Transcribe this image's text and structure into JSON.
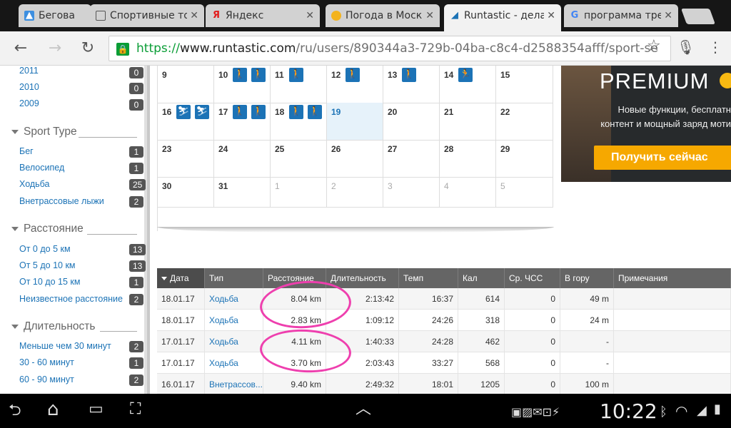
{
  "browser": {
    "tabs": [
      {
        "label": "Беговая с",
        "favicon": "drive-icon",
        "active": false
      },
      {
        "label": "Спортивные то",
        "favicon": "page-icon",
        "active": false
      },
      {
        "label": "Яндекс",
        "favicon": "yandex-icon",
        "active": false
      },
      {
        "label": "Погода в Моск",
        "favicon": "weather-icon",
        "active": false
      },
      {
        "label": "Runtastic - дела",
        "favicon": "runtastic-icon",
        "active": true
      },
      {
        "label": "программа тре",
        "favicon": "google-icon",
        "active": false
      }
    ],
    "url": {
      "scheme": "https://",
      "host": "www.runtastic.com",
      "path": "/ru/users/890344a3-729b-04ba-c8c4-d2588354afff/sport-se"
    }
  },
  "sidebar": {
    "years": [
      {
        "label": "2011",
        "count": "0"
      },
      {
        "label": "2010",
        "count": "0"
      },
      {
        "label": "2009",
        "count": "0"
      }
    ],
    "sport_type": {
      "heading": "Sport Type",
      "items": [
        {
          "label": "Бег",
          "count": "1"
        },
        {
          "label": "Велосипед",
          "count": "1"
        },
        {
          "label": "Ходьба",
          "count": "25"
        },
        {
          "label": "Внетрассовые лыжи",
          "count": "2"
        }
      ]
    },
    "distance": {
      "heading": "Расстояние",
      "items": [
        {
          "label": "От 0 до 5 км",
          "count": "13"
        },
        {
          "label": "От 5 до 10 км",
          "count": "13"
        },
        {
          "label": "От 10 до 15 км",
          "count": "1"
        },
        {
          "label": "Неизвестное расстояние",
          "count": "2"
        }
      ]
    },
    "duration": {
      "heading": "Длительность",
      "items": [
        {
          "label": "Меньше чем 30 минут",
          "count": "2"
        },
        {
          "label": "30 - 60 минут",
          "count": "1"
        },
        {
          "label": "60 - 90 минут",
          "count": "2"
        }
      ]
    }
  },
  "calendar": {
    "weeks": [
      [
        {
          "day": "9",
          "icons": []
        },
        {
          "day": "10",
          "icons": [
            "walking-icon",
            "walking-icon"
          ]
        },
        {
          "day": "11",
          "icons": [
            "walking-icon"
          ]
        },
        {
          "day": "12",
          "icons": [
            "walking-icon"
          ]
        },
        {
          "day": "13",
          "icons": [
            "walking-icon"
          ]
        },
        {
          "day": "14",
          "icons": [
            "running-icon"
          ]
        },
        {
          "day": "15",
          "icons": []
        }
      ],
      [
        {
          "day": "16",
          "icons": [
            "skiing-icon",
            "skiing-icon"
          ]
        },
        {
          "day": "17",
          "icons": [
            "walking-icon",
            "walking-icon"
          ]
        },
        {
          "day": "18",
          "icons": [
            "walking-icon",
            "walking-icon"
          ]
        },
        {
          "day": "19",
          "icons": [],
          "today": true
        },
        {
          "day": "20",
          "icons": []
        },
        {
          "day": "21",
          "icons": []
        },
        {
          "day": "22",
          "icons": []
        }
      ],
      [
        {
          "day": "23",
          "icons": []
        },
        {
          "day": "24",
          "icons": []
        },
        {
          "day": "25",
          "icons": []
        },
        {
          "day": "26",
          "icons": []
        },
        {
          "day": "27",
          "icons": []
        },
        {
          "day": "28",
          "icons": []
        },
        {
          "day": "29",
          "icons": []
        }
      ],
      [
        {
          "day": "30",
          "icons": []
        },
        {
          "day": "31",
          "icons": []
        },
        {
          "day": "1",
          "icons": [],
          "muted": true
        },
        {
          "day": "2",
          "icons": [],
          "muted": true
        },
        {
          "day": "3",
          "icons": [],
          "muted": true
        },
        {
          "day": "4",
          "icons": [],
          "muted": true
        },
        {
          "day": "5",
          "icons": [],
          "muted": true
        }
      ]
    ]
  },
  "ad": {
    "premium": "PREMIUM",
    "line1": "Новые функции, бесплатн",
    "line2": "контент и мощный заряд моти",
    "cta": "Получить сейчас"
  },
  "table": {
    "headers": [
      "Дата",
      "Тип",
      "Расстояние",
      "Длительность",
      "Темп",
      "Кал",
      "Ср. ЧСС",
      "В гору",
      "Примечания"
    ],
    "rows": [
      [
        "18.01.17",
        "Ходьба",
        "8.04 km",
        "2:13:42",
        "16:37",
        "614",
        "0",
        "49 m",
        ""
      ],
      [
        "18.01.17",
        "Ходьба",
        "2.83 km",
        "1:09:12",
        "24:26",
        "318",
        "0",
        "24 m",
        ""
      ],
      [
        "17.01.17",
        "Ходьба",
        "4.11 km",
        "1:40:33",
        "24:28",
        "462",
        "0",
        "-",
        ""
      ],
      [
        "17.01.17",
        "Ходьба",
        "3.70 km",
        "2:03:43",
        "33:27",
        "568",
        "0",
        "-",
        ""
      ],
      [
        "16.01.17",
        "Внетрассов...",
        "9.40 km",
        "2:49:32",
        "18:01",
        "1205",
        "0",
        "100 m",
        ""
      ]
    ]
  },
  "system": {
    "time": "10:22"
  },
  "colors": {
    "link": "#1c73b6",
    "annotation": "#ee3fae",
    "https": "#0a9d36",
    "cta": "#f6a800"
  }
}
